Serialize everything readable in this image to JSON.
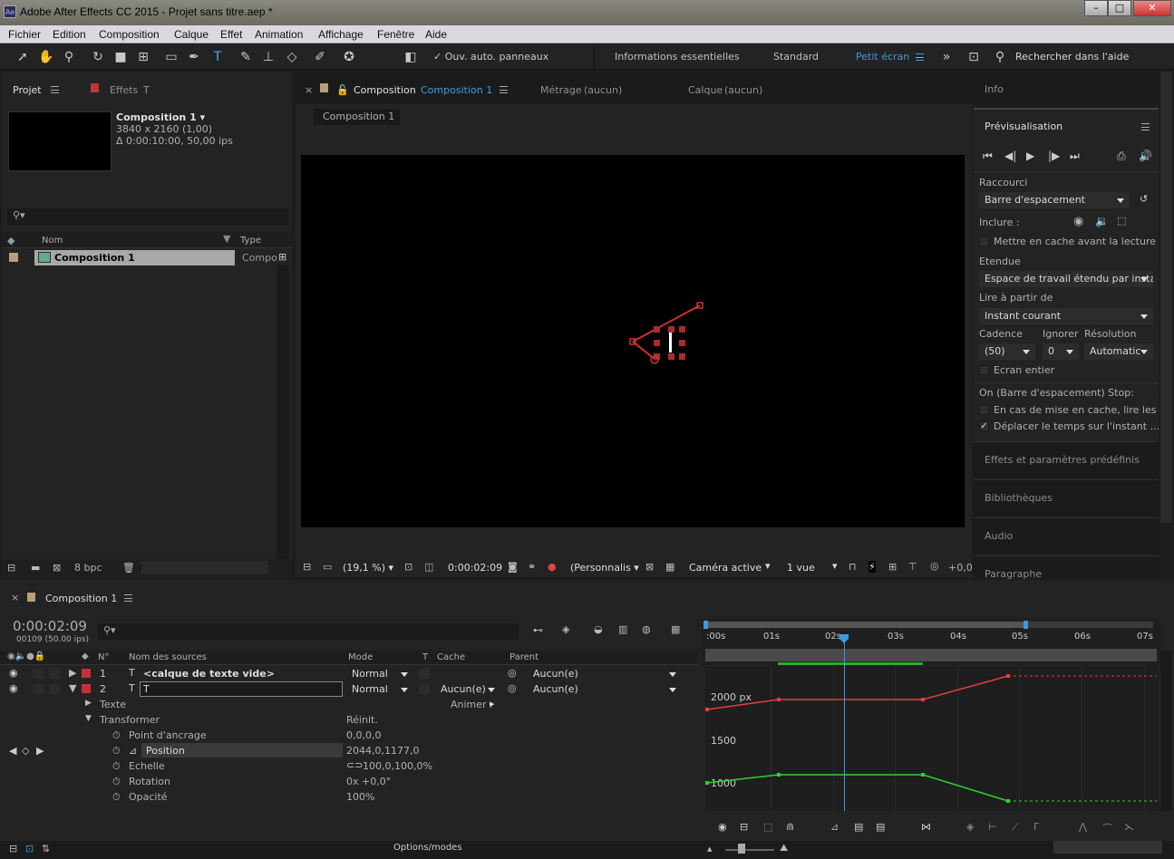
{
  "window": {
    "title": "Adobe After Effects CC 2015 - Projet sans titre.aep *",
    "app_badge": "Ae"
  },
  "menu": [
    "Fichier",
    "Edition",
    "Composition",
    "Calque",
    "Effet",
    "Animation",
    "Affichage",
    "Fenêtre",
    "Aide"
  ],
  "toolbar": {
    "auto_panels": "Ouv. auto. panneaux",
    "workspaces": [
      "Informations essentielles",
      "Standard",
      "Petit écran"
    ],
    "active_workspace": "Petit écran",
    "search_help": "Rechercher dans l'aide"
  },
  "project": {
    "tab_project": "Projet",
    "tab_effects": "Effets",
    "tab_effects_suffix": "T",
    "comp_name": "Composition 1",
    "comp_size": "3840 x 2160 (1,00)",
    "comp_duration": "Δ 0:00:10:00, 50,00 ips",
    "col_name": "Nom",
    "col_type": "Type",
    "item_name": "Composition 1",
    "item_type": "Compo",
    "bpc": "8 bpc"
  },
  "composition": {
    "tab_label": "Composition",
    "tab_comp": "Composition 1",
    "tab_footage": "Métrage",
    "tab_footage_value": "(aucun)",
    "tab_layer": "Calque",
    "tab_layer_value": "(aucun)",
    "breadcrumb": "Composition 1",
    "zoom": "(19,1 %)",
    "timecode": "0:00:02:09",
    "resolution": "(Personnalis",
    "camera": "Caméra active",
    "views": "1 vue",
    "exposure": "+0,0"
  },
  "right_panel": {
    "info": "Info",
    "preview": "Prévisualisation",
    "shortcut_label": "Raccourci",
    "shortcut_value": "Barre d'espacement",
    "include_label": "Inclure :",
    "cache_before": "Mettre en cache avant la lecture",
    "range_label": "Etendue",
    "range_value": "Espace de travail étendu par insta",
    "play_from_label": "Lire à partir de",
    "play_from_value": "Instant courant",
    "framerate_label": "Cadence",
    "skip_label": "Ignorer",
    "resolution_label": "Résolution",
    "framerate_value": "(50)",
    "skip_value": "0",
    "resolution_value": "Automatic",
    "fullscreen": "Ecran entier",
    "on_stop_label": "On (Barre d'espacement) Stop:",
    "if_cached": "En cas de mise en cache, lire les ...",
    "move_time": "Déplacer le temps sur l'instant ...",
    "effects_presets": "Effets et paramètres prédéfinis",
    "libraries": "Bibliothèques",
    "audio": "Audio",
    "paragraph": "Paragraphe"
  },
  "timeline": {
    "tab": "Composition 1",
    "timecode": "0:00:02:09",
    "frame_info": "00109 (50.00 ips)",
    "col_num": "N°",
    "col_source": "Nom des sources",
    "col_mode": "Mode",
    "col_t": "T",
    "col_cache": "Cache",
    "col_parent": "Parent",
    "layers": [
      {
        "num": "1",
        "name": "<calque de texte vide>",
        "mode": "Normal",
        "cache": "",
        "parent": "Aucun(e)"
      },
      {
        "num": "2",
        "name": "T",
        "mode": "Normal",
        "cache": "Aucun(e)",
        "parent": "Aucun(e)"
      }
    ],
    "text_group": "Texte",
    "animate": "Animer :",
    "transform": "Transformer",
    "reset": "Réinit.",
    "props": [
      {
        "name": "Point d'ancrage",
        "value": "0,0,0,0"
      },
      {
        "name": "Position",
        "value": "2044,0,1177,0"
      },
      {
        "name": "Echelle",
        "value": "100,0,100,0%"
      },
      {
        "name": "Rotation",
        "value": "0x +0,0°"
      },
      {
        "name": "Opacité",
        "value": "100%"
      }
    ],
    "ruler": [
      ":00s",
      "01s",
      "02s",
      "03s",
      "04s",
      "05s",
      "06s",
      "07s"
    ],
    "graph_labels": [
      "2000 px",
      "1500",
      "1000"
    ],
    "toggle": "Options/modes"
  },
  "colors": {
    "accent": "#3d9bdc",
    "red_curve": "#e0403a",
    "green_curve": "#30d030",
    "label_red": "#c0333a",
    "label_tan": "#b89e7a"
  }
}
